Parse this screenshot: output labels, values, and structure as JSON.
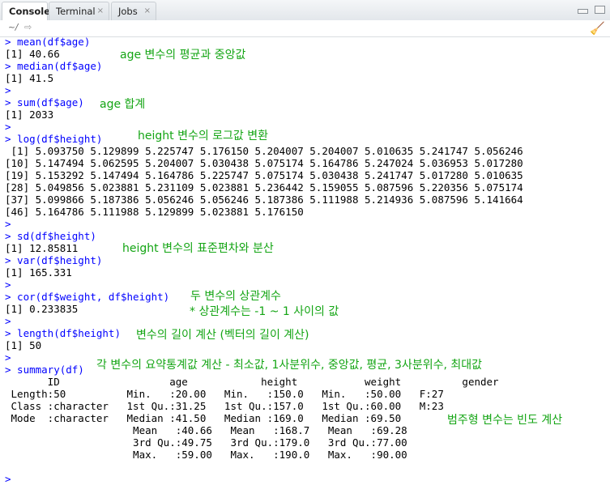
{
  "tabs": [
    {
      "label": "Console",
      "closable": false
    },
    {
      "label": "Terminal",
      "closable": true
    },
    {
      "label": "Jobs",
      "closable": true
    }
  ],
  "tab_close_glyph": "×",
  "path": "~/",
  "prompt": ">",
  "colors": {
    "command": "#0000ff",
    "output": "#000000",
    "annotation": "#14a514",
    "tab_bar": "#e3e7eb"
  },
  "console_lines": [
    {
      "kind": "cmd",
      "text": "> mean(df$age)"
    },
    {
      "kind": "out",
      "text": "[1] 40.66"
    },
    {
      "kind": "cmd",
      "text": "> median(df$age)"
    },
    {
      "kind": "out",
      "text": "[1] 41.5"
    },
    {
      "kind": "cmd",
      "text": ">"
    },
    {
      "kind": "cmd",
      "text": "> sum(df$age)"
    },
    {
      "kind": "out",
      "text": "[1] 2033"
    },
    {
      "kind": "cmd",
      "text": ">"
    },
    {
      "kind": "cmd",
      "text": "> log(df$height)"
    },
    {
      "kind": "out",
      "text": " [1] 5.093750 5.129899 5.225747 5.176150 5.204007 5.204007 5.010635 5.241747 5.056246"
    },
    {
      "kind": "out",
      "text": "[10] 5.147494 5.062595 5.204007 5.030438 5.075174 5.164786 5.247024 5.036953 5.017280"
    },
    {
      "kind": "out",
      "text": "[19] 5.153292 5.147494 5.164786 5.225747 5.075174 5.030438 5.241747 5.017280 5.010635"
    },
    {
      "kind": "out",
      "text": "[28] 5.049856 5.023881 5.231109 5.023881 5.236442 5.159055 5.087596 5.220356 5.075174"
    },
    {
      "kind": "out",
      "text": "[37] 5.099866 5.187386 5.056246 5.056246 5.187386 5.111988 5.214936 5.087596 5.141664"
    },
    {
      "kind": "out",
      "text": "[46] 5.164786 5.111988 5.129899 5.023881 5.176150"
    },
    {
      "kind": "cmd",
      "text": ">"
    },
    {
      "kind": "cmd",
      "text": "> sd(df$height)"
    },
    {
      "kind": "out",
      "text": "[1] 12.85811"
    },
    {
      "kind": "cmd",
      "text": "> var(df$height)"
    },
    {
      "kind": "out",
      "text": "[1] 165.331"
    },
    {
      "kind": "cmd",
      "text": ">"
    },
    {
      "kind": "cmd",
      "text": "> cor(df$weight, df$height)"
    },
    {
      "kind": "out",
      "text": "[1] 0.233835"
    },
    {
      "kind": "cmd",
      "text": ">"
    },
    {
      "kind": "cmd",
      "text": "> length(df$height)"
    },
    {
      "kind": "out",
      "text": "[1] 50"
    },
    {
      "kind": "cmd",
      "text": ">"
    },
    {
      "kind": "cmd",
      "text": "> summary(df)"
    },
    {
      "kind": "out",
      "text": "       ID                  age            height           weight          gender"
    },
    {
      "kind": "out",
      "text": " Length:50          Min.   :20.00   Min.   :150.0   Min.   :50.00   F:27"
    },
    {
      "kind": "out",
      "text": " Class :character   1st Qu.:31.25   1st Qu.:157.0   1st Qu.:60.00   M:23"
    },
    {
      "kind": "out",
      "text": " Mode  :character   Median :41.50   Median :169.0   Median :69.50"
    },
    {
      "kind": "out",
      "text": "                     Mean   :40.66   Mean   :168.7   Mean   :69.28"
    },
    {
      "kind": "out",
      "text": "                     3rd Qu.:49.75   3rd Qu.:179.0   3rd Qu.:77.00"
    },
    {
      "kind": "out",
      "text": "                     Max.   :59.00   Max.   :190.0   Max.   :90.00"
    },
    {
      "kind": "cmd",
      "text": ""
    },
    {
      "kind": "cmd",
      "text": ">"
    }
  ],
  "annotations": [
    {
      "text": "age 변수의 평균과 중앙값"
    },
    {
      "text": "age 합계"
    },
    {
      "text": "height 변수의 로그값 변환"
    },
    {
      "text": "height 변수의 표준편차와 분산"
    },
    {
      "text": "두 변수의 상관계수"
    },
    {
      "text": "* 상관계수는 -1 ~ 1 사이의 값"
    },
    {
      "text": "변수의 길이 계산 (벡터의 길이 계산)"
    },
    {
      "text": "각 변수의 요약통계값 계산 - 최소값, 1사분위수, 중앙값, 평균, 3사분위수, 최대값"
    },
    {
      "text": "범주형 변수는 빈도 계산"
    }
  ]
}
